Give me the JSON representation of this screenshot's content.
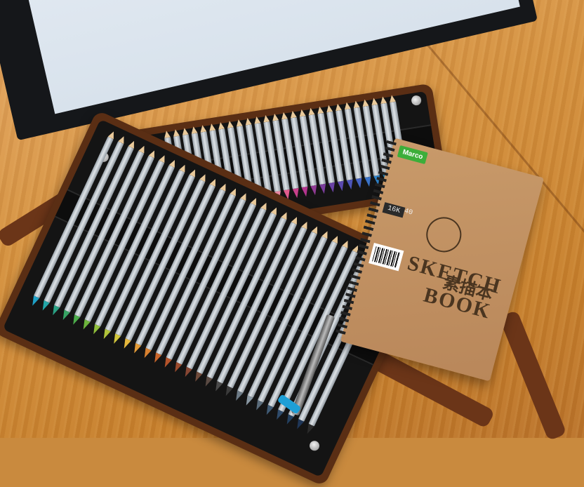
{
  "sketchbook": {
    "brand": "Marco",
    "title_cn": "素描本",
    "title_en_1": "SKETCH",
    "title_en_2": "BOOK",
    "size": "16K",
    "count": "40"
  },
  "colors": {
    "desk": "#d4913f",
    "roll_fabric": "#5a2e14",
    "roll_inside": "#141414",
    "brand_green": "#3cae3a"
  },
  "pencil_colors_top": [
    "#ffffff",
    "#f5e27a",
    "#f2c84b",
    "#f4a43a",
    "#f0872e",
    "#ea6a30",
    "#e14f35",
    "#d8383a",
    "#cf2b3f",
    "#c7244a",
    "#ef6f8a",
    "#f28ca8",
    "#e35d8f",
    "#c8408b",
    "#b3348e",
    "#8f3a93",
    "#7a3d9c",
    "#6a42a6",
    "#5b49b0",
    "#4d55b9",
    "#4361c0",
    "#3a73c8",
    "#2f86cf",
    "#2b98d2",
    "#2aaad3",
    "#33b9c9"
  ],
  "pencil_colors_bottom": [
    "#1ea0c6",
    "#23a6a8",
    "#2aa184",
    "#36a363",
    "#4bab4a",
    "#6db53c",
    "#8fbd3a",
    "#b1c43a",
    "#d2c63c",
    "#e6b83c",
    "#e39b38",
    "#d8802f",
    "#c9652a",
    "#b4532a",
    "#9b4a2c",
    "#874633",
    "#6f4a3a",
    "#5a4a43",
    "#4a4a4a",
    "#3b3b3b",
    "#6c7a86",
    "#8a98a3",
    "#5a6b7a",
    "#3f5a74",
    "#2f4b6b",
    "#23405f",
    "#1f3657",
    "#2b2b2b"
  ]
}
